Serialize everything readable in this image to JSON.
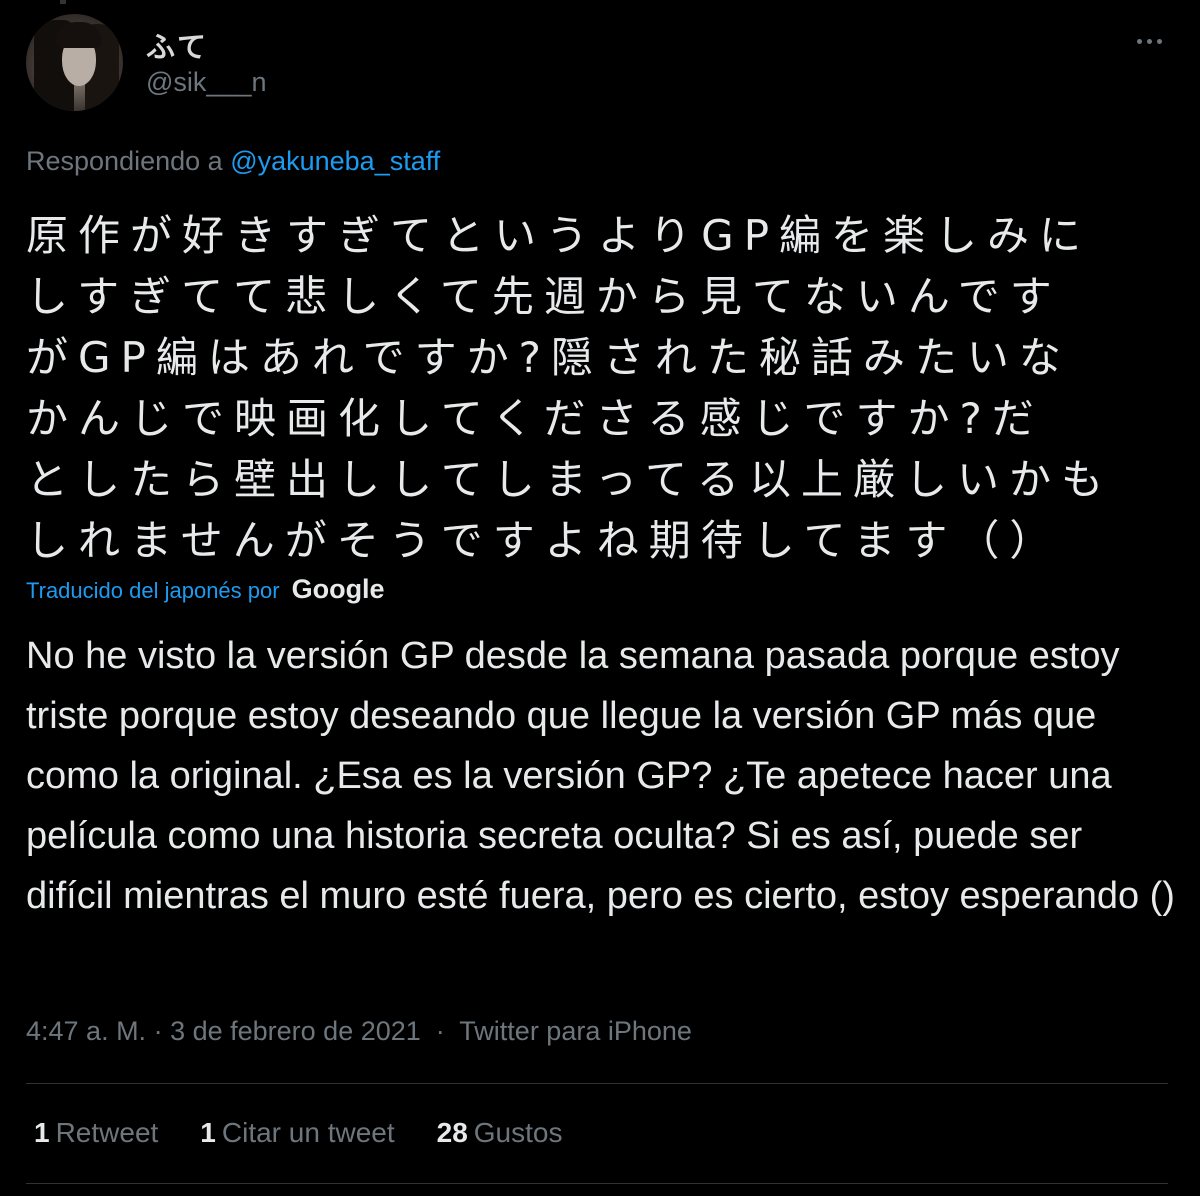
{
  "author": {
    "display_name": "ふて",
    "handle": "@sik___n"
  },
  "reply": {
    "prefix": "Respondiendo a",
    "to_handle": "@yakuneba_staff"
  },
  "tweet": {
    "original_text": "原作が好きすぎてというよりGP編を楽しみに\nしすぎてて悲しくて先週から見てないんです\nがGP編はあれですか?隠された秘話みたいな\nかんじで映画化してくださる感じですか?だ\nとしたら壁出ししてしまってる以上厳しいかも\nしれませんがそうですよね期待してます（）",
    "translated_label": "Traducido del japonés por",
    "translator": "Google",
    "translated_text": "No he visto la versión GP desde la semana pasada porque estoy triste porque estoy deseando que llegue la versión GP más que como la original. ¿Esa es la versión GP? ¿Te apetece hacer una película como una historia secreta oculta? Si es así, puede ser difícil mientras el muro esté fuera, pero es cierto, estoy esperando ()"
  },
  "meta": {
    "time": "4:47 a. M.",
    "separator": " · ",
    "date": "3 de febrero de 2021",
    "separator2": "  ·  ",
    "source": "Twitter para iPhone"
  },
  "stats": {
    "retweets_count": "1",
    "retweets_label": "Retweet",
    "quotes_count": "1",
    "quotes_label": "Citar un tweet",
    "likes_count": "28",
    "likes_label": "Gustos"
  },
  "colors": {
    "background": "#000000",
    "link": "#1d9bf0",
    "secondary_text": "#6e767d",
    "primary_text": "#e7e9ea"
  },
  "icons": {
    "more": "more-horizontal-icon"
  }
}
